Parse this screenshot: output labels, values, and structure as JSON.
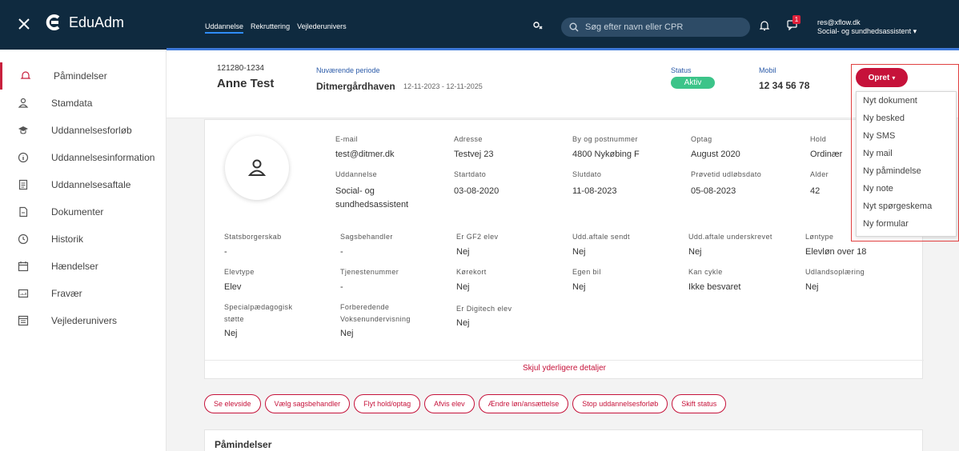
{
  "app": {
    "name": "EduAdm"
  },
  "topnav": [
    "Uddannelse",
    "Rekruttering",
    "Vejlederunivers"
  ],
  "search": {
    "placeholder": "Søg efter navn eller CPR"
  },
  "notifications": {
    "count": "1"
  },
  "user": {
    "email": "res@xflow.dk",
    "role": "Social- og sundhedsassistent"
  },
  "sidebar": {
    "items": [
      {
        "label": "Påmindelser",
        "icon": "bell-icon"
      },
      {
        "label": "Stamdata",
        "icon": "person-icon"
      },
      {
        "label": "Uddannelsesforløb",
        "icon": "graduation-cap-icon"
      },
      {
        "label": "Uddannelsesinformation",
        "icon": "info-icon"
      },
      {
        "label": "Uddannelsesaftale",
        "icon": "document-icon"
      },
      {
        "label": "Dokumenter",
        "icon": "file-icon"
      },
      {
        "label": "Historik",
        "icon": "clock-icon"
      },
      {
        "label": "Hændelser",
        "icon": "calendar-icon"
      },
      {
        "label": "Fravær",
        "icon": "chart-icon"
      },
      {
        "label": "Vejlederunivers",
        "icon": "list-icon"
      }
    ]
  },
  "student": {
    "cpr": "121280-1234",
    "name": "Anne Test",
    "period_label": "Nuværende periode",
    "period_place": "Ditmergårdhaven",
    "period_dates": "12-11-2023 - 12-11-2025",
    "status_label": "Status",
    "status_value": "Aktiv",
    "mobile_label": "Mobil",
    "mobile_value": "12 34 56 78"
  },
  "opret": {
    "label": "Opret",
    "items": [
      "Nyt dokument",
      "Ny besked",
      "Ny SMS",
      "Ny mail",
      "Ny påmindelse",
      "Ny note",
      "Nyt spørgeskema",
      "Ny formular"
    ]
  },
  "details": {
    "top": [
      {
        "label": "E-mail",
        "value": "test@ditmer.dk"
      },
      {
        "label": "Adresse",
        "value": "Testvej 23"
      },
      {
        "label": "By og postnummer",
        "value": "4800 Nykøbing F"
      },
      {
        "label": "Optag",
        "value": "August 2020"
      },
      {
        "label": "Hold",
        "value": "Ordinær"
      },
      {
        "label": "Uddannelse",
        "value": "Social- og sundhedsassistent"
      },
      {
        "label": "Startdato",
        "value": "03-08-2020"
      },
      {
        "label": "Slutdato",
        "value": "11-08-2023"
      },
      {
        "label": "Prøvetid udløbsdato",
        "value": "05-08-2023"
      },
      {
        "label": "Alder",
        "value": "42"
      }
    ],
    "grid": [
      {
        "label": "Statsborgerskab",
        "value": "-"
      },
      {
        "label": "Sagsbehandler",
        "value": "-"
      },
      {
        "label": "Er GF2 elev",
        "value": "Nej"
      },
      {
        "label": "Udd.aftale sendt",
        "value": "Nej"
      },
      {
        "label": "Udd.aftale underskrevet",
        "value": "Nej"
      },
      {
        "label": "Løntype",
        "value": "Elevløn over 18"
      },
      {
        "label": "Elevtype",
        "value": "Elev"
      },
      {
        "label": "Tjenestenummer",
        "value": "-"
      },
      {
        "label": "Kørekort",
        "value": "Nej"
      },
      {
        "label": "Egen bil",
        "value": "Nej"
      },
      {
        "label": "Kan cykle",
        "value": "Ikke besvaret"
      },
      {
        "label": "Udlandsoplæring",
        "value": "Nej"
      },
      {
        "label": "Specialpædagogisk støtte",
        "value": "Nej"
      },
      {
        "label": "Forberedende Voksenundervisning",
        "value": "Nej"
      },
      {
        "label": "Er Digitech elev",
        "value": "Nej"
      }
    ],
    "hide_link": "Skjul yderligere detaljer"
  },
  "actions": [
    "Se elevside",
    "Vælg sagsbehandler",
    "Flyt hold/optag",
    "Afvis elev",
    "Ændre løn/ansættelse",
    "Stop uddannelsesforløb",
    "Skift status"
  ],
  "section_title": "Påmindelser",
  "colors": {
    "header": "#0f2a3f",
    "accent": "#c6123a",
    "status": "#3cc489"
  }
}
